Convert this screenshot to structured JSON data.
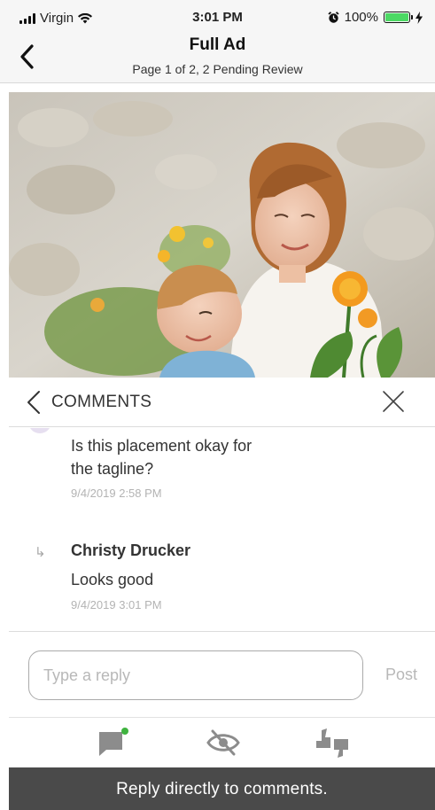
{
  "status_bar": {
    "carrier": "Virgin",
    "time": "3:01 PM",
    "battery_percent": "100%",
    "battery_level": 1.0,
    "icons": [
      "signal-bars-icon",
      "wifi-icon",
      "alarm-icon",
      "battery-icon",
      "charging-bolt-icon"
    ]
  },
  "nav": {
    "title": "Full Ad",
    "subtitle": "Page 1 of 2, 2 Pending Review",
    "back_icon": "chevron-left-icon"
  },
  "ad": {
    "image_description_icon": "ad-photo"
  },
  "comments": {
    "title": "COMMENTS",
    "back_icon": "chevron-left-icon",
    "close_icon": "close-icon",
    "items": [
      {
        "author": "",
        "text_line1": "Is this placement okay for",
        "text_line2": "the tagline?",
        "time": "9/4/2019 2:58 PM"
      },
      {
        "reply_marker": "↳",
        "author": "Christy Drucker",
        "text": "Looks good",
        "time": "9/4/2019 3:01 PM"
      }
    ]
  },
  "reply": {
    "placeholder": "Type a reply",
    "value": "",
    "post_label": "Post"
  },
  "toolbar": {
    "items": [
      "comment-icon",
      "hide-eye-icon",
      "thumbs-vote-icon"
    ],
    "indicator_color": "#3fb33f"
  },
  "caption": "Reply directly to comments.",
  "colors": {
    "accent_gray": "#4a4a4a",
    "icon_gray": "#8c8c8c",
    "battery_green": "#4cd964"
  }
}
